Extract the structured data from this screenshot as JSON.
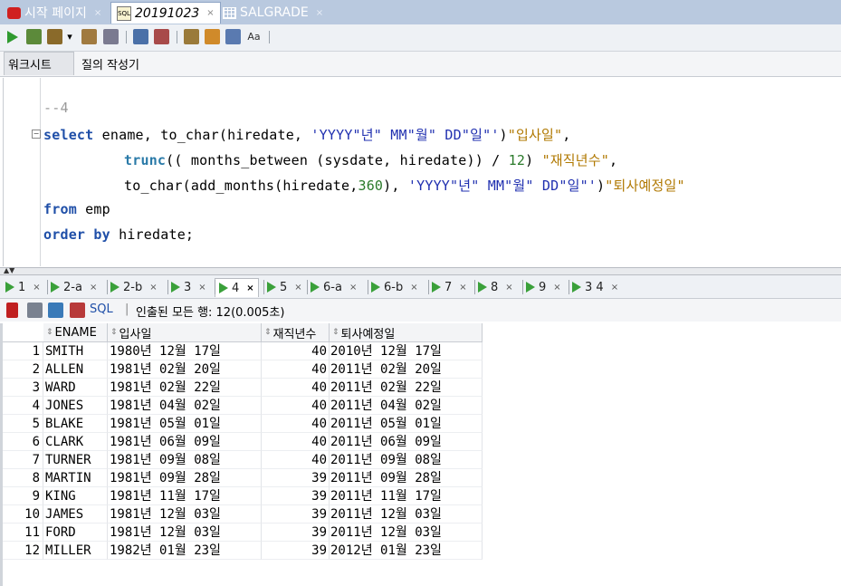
{
  "doc_tabs": [
    {
      "label": "시작 페이지",
      "close": "×",
      "icon": "oracle-icon"
    },
    {
      "label": "20191023",
      "close": "×",
      "icon": "sql-worksheet-icon"
    },
    {
      "label": "SALGRADE",
      "close": "×",
      "icon": "table-icon"
    }
  ],
  "sub_tabs": {
    "worksheet": "워크시트",
    "query_builder": "질의 작성기"
  },
  "editor": {
    "line1": "--4",
    "line2": {
      "kw": "select",
      "a": " ename, to_char(hiredate, ",
      "fmt": "'YYYY\"년\" MM\"월\" DD\"일\"'",
      "b": ")",
      "alias": "\"입사일\"",
      "c": ","
    },
    "line3": {
      "fn": "trunc",
      "a": "(( months_between (sysdate, hiredate)) / ",
      "num": "12",
      "b": ") ",
      "alias": "\"재직년수\"",
      "c": ","
    },
    "line4": {
      "a": "to_char(add_months(hiredate,",
      "num": "360",
      "b": "), ",
      "fmt": "'YYYY\"년\" MM\"월\" DD\"일\"'",
      "c": ")",
      "alias": "\"퇴사예정일\""
    },
    "line5": {
      "kw": "from",
      "a": " emp"
    },
    "line6": {
      "kw": "order by",
      "a": " hiredate;"
    }
  },
  "result_tabs": [
    {
      "label": "1",
      "close": "×"
    },
    {
      "label": "2-a",
      "close": "×"
    },
    {
      "label": "2-b",
      "close": "×"
    },
    {
      "label": "3",
      "close": "×"
    },
    {
      "label": "4",
      "close": "×",
      "active": true
    },
    {
      "label": "5",
      "close": "×"
    },
    {
      "label": "6-a",
      "close": "×"
    },
    {
      "label": "6-b",
      "close": "×"
    },
    {
      "label": "7",
      "close": "×"
    },
    {
      "label": "8",
      "close": "×"
    },
    {
      "label": "9",
      "close": "×"
    },
    {
      "label": "3 4",
      "close": "×"
    }
  ],
  "result_toolbar": {
    "sql_label": "SQL",
    "status": "인출된 모든 행: 12(0.005초)"
  },
  "grid": {
    "columns": [
      "ENAME",
      "입사일",
      "재직년수",
      "퇴사예정일"
    ],
    "rows": [
      [
        "1",
        "SMITH",
        "1980년 12월 17일",
        "40",
        "2010년 12월 17일"
      ],
      [
        "2",
        "ALLEN",
        "1981년 02월 20일",
        "40",
        "2011년 02월 20일"
      ],
      [
        "3",
        "WARD",
        "1981년 02월 22일",
        "40",
        "2011년 02월 22일"
      ],
      [
        "4",
        "JONES",
        "1981년 04월 02일",
        "40",
        "2011년 04월 02일"
      ],
      [
        "5",
        "BLAKE",
        "1981년 05월 01일",
        "40",
        "2011년 05월 01일"
      ],
      [
        "6",
        "CLARK",
        "1981년 06월 09일",
        "40",
        "2011년 06월 09일"
      ],
      [
        "7",
        "TURNER",
        "1981년 09월 08일",
        "40",
        "2011년 09월 08일"
      ],
      [
        "8",
        "MARTIN",
        "1981년 09월 28일",
        "39",
        "2011년 09월 28일"
      ],
      [
        "9",
        "KING",
        "1981년 11월 17일",
        "39",
        "2011년 11월 17일"
      ],
      [
        "10",
        "JAMES",
        "1981년 12월 03일",
        "39",
        "2011년 12월 03일"
      ],
      [
        "11",
        "FORD",
        "1981년 12월 03일",
        "39",
        "2011년 12월 03일"
      ],
      [
        "12",
        "MILLER",
        "1982년 01월 23일",
        "39",
        "2012년 01월 23일"
      ]
    ]
  },
  "colors": {
    "keyword": "#1f4fa8",
    "string": "#2030b0",
    "alias": "#b07800",
    "number": "#2a7a2a",
    "run_green": "#3aa03a"
  }
}
